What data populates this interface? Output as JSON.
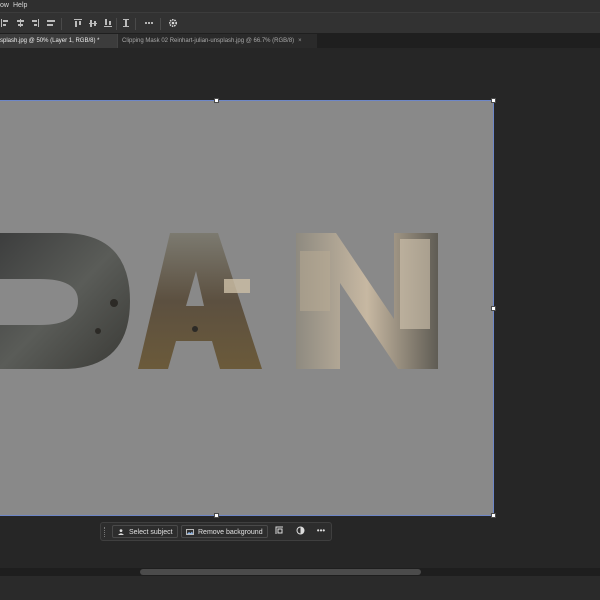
{
  "menu": {
    "item_left": "ow",
    "item_help": "Help"
  },
  "toolbar": {
    "icons": [
      "align-left-icon",
      "align-center-icon",
      "align-right-icon",
      "align-justify-icon",
      "align-top-icon",
      "align-vmiddle-icon",
      "align-bottom-icon",
      "distribute-icon",
      "more-icon",
      "settings-icon"
    ]
  },
  "tabs": [
    {
      "label": "splash.jpg @ 50% (Layer 1, RGB/8) *",
      "active": true
    },
    {
      "label": "Clipping Mask 02 Reinhart-julian-unsplash.jpg @ 66.7% (RGB/8)",
      "active": false,
      "close": "×"
    }
  ],
  "canvas": {
    "text": "DAN",
    "bg_color": "#898989",
    "selection_color": "#6d86c7"
  },
  "taskbar": {
    "select_subject": "Select subject",
    "remove_background": "Remove background",
    "more": "•••"
  }
}
